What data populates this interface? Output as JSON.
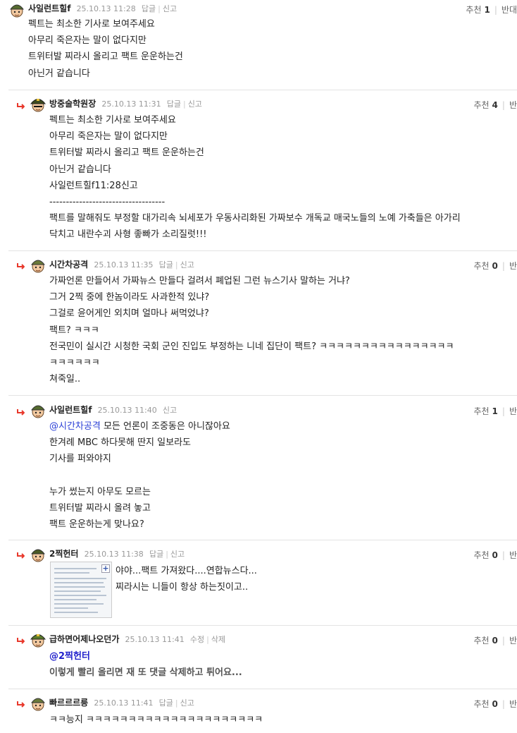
{
  "ui": {
    "reply_label": "답글",
    "report_label": "신고",
    "edit_label": "수정",
    "delete_label": "삭제",
    "recommend_label": "추천",
    "oppose_first": "반대",
    "oppose_rest": "반"
  },
  "comments": [
    {
      "nickname": "사일런트힐f",
      "date": "25.10.13 11:28",
      "recommend": "1",
      "lines": [
        "펙트는 최소한 기사로 보여주세요",
        "아무리 죽은자는 말이 없다지만",
        "트위터발 찌라시 올리고 팩트 운운하는건",
        "아닌거 같습니다"
      ]
    },
    {
      "nickname": "방중술학원장",
      "date": "25.10.13 11:31",
      "recommend": "4",
      "lines": [
        "펙트는 최소한 기사로 보여주세요",
        "아무리 죽은자는 말이 없다지만",
        "트위터발 찌라시 올리고 팩트 운운하는건",
        "아닌거 같습니다",
        "사일런트힐f11:28신고",
        "-----------------------------------",
        "팩트를 말해줘도 부정할 대가리속 뇌세포가 우동사리화된 가짜보수 개독교 매국노들의 노예 가축들은 아가리",
        "닥치고 내란수괴 사형 좋빠가 소리질럿!!!"
      ]
    },
    {
      "nickname": "시간차공격",
      "date": "25.10.13 11:35",
      "recommend": "0",
      "lines": [
        "가짜언론 만들어서 가짜뉴스 만들다 걸려서 폐업된 그런 뉴스기사 말하는 거냐?",
        "그거 2찍 중에 한놈이라도 사과한적 있냐?",
        "그걸로 윤어게인 외치며 얼마나 써먹었냐?",
        "팩트? ㅋㅋㅋ",
        "전국민이 실시간 시청한 국회 군인 진입도 부정하는 니네 집단이 팩트? ㅋㅋㅋㅋㅋㅋㅋㅋㅋㅋㅋㅋㅋㅋㅋㅋ",
        "ㅋㅋㅋㅋㅋㅋ",
        "쳐죽일.."
      ]
    },
    {
      "nickname": "사일런트힐f",
      "date": "25.10.13 11:40",
      "recommend": "1",
      "mention": "@시간차공격",
      "first_line_rest": " 모든 언론이 조중동은 아니잖아요",
      "lines": [
        "한겨례 MBC 하다못해 딴지 일보라도",
        "기사를 퍼와야지",
        "",
        "누가 썼는지 아무도 모르는",
        "트위터발 찌라시 올려 놓고",
        "팩트 운운하는게 맞나요?"
      ]
    },
    {
      "nickname": "2찍헌터",
      "date": "25.10.13 11:38",
      "recommend": "0",
      "lines": [
        "야야...팩트 가져왔다....연합뉴스다...",
        "찌라시는 니들이 항상 하는짓이고.."
      ]
    },
    {
      "nickname": "급하면어제나오던가",
      "date": "25.10.13 11:41",
      "recommend": "0",
      "mention": "@2찍헌터",
      "lines": [
        "이렇게 빨리 올리면 재 또 댓글 삭제하고 튀어요..."
      ]
    },
    {
      "nickname": "빠르르르릉",
      "date": "25.10.13 11:41",
      "recommend": "0",
      "lines": [
        "ㅋㅋ능지 ㅋㅋㅋㅋㅋㅋㅋㅋㅋㅋㅋㅋㅋㅋㅋㅋㅋㅋㅋㅋㅋ"
      ]
    }
  ],
  "colors": {
    "reply_arrow": "#e8382b",
    "mention": "#2a3fd6",
    "divider": "#e3e3e3"
  },
  "icons": [
    "reply-arrow-icon",
    "soldier-avatar-icon",
    "general-avatar-icon"
  ]
}
